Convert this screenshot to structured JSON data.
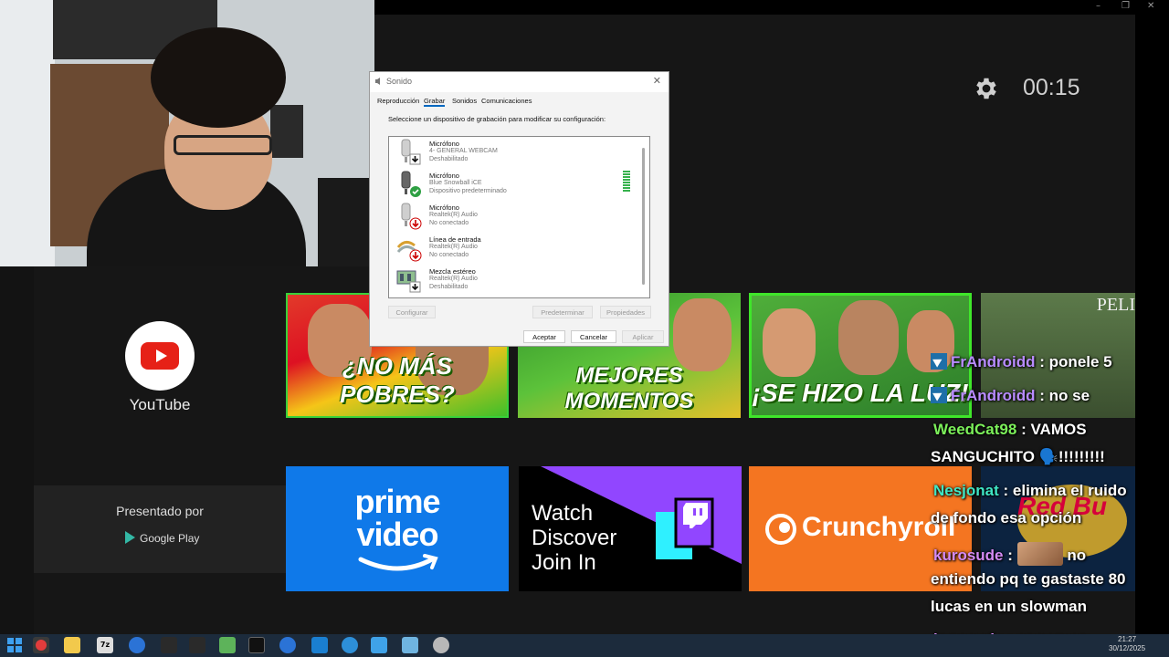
{
  "tv": {
    "clock": "00:15",
    "window_controls": [
      "–",
      "❐",
      "✕"
    ],
    "youtube_label": "YouTube",
    "thumbnails": [
      {
        "caption": "¿NO MÁS POBRES?"
      },
      {
        "caption": "MEJORES MOMENTOS"
      },
      {
        "caption": "¡SE HIZO LA LUZ!"
      },
      {
        "caption": "PELI"
      }
    ],
    "sponsored_title": "Presentado por",
    "sponsored_store": "Google Play",
    "apps": {
      "prime_line1": "prime",
      "prime_line2": "video",
      "twitch_line1": "Watch",
      "twitch_line2": "Discover",
      "twitch_line3": "Join In",
      "crunchyroll": "Crunchyroll"
    }
  },
  "dialog": {
    "title": "Sonido",
    "close": "✕",
    "tabs": [
      "Reproducción",
      "Grabar",
      "Sonidos",
      "Comunicaciones"
    ],
    "active_tab": "Grabar",
    "instruction": "Seleccione un dispositivo de grabación para modificar su configuración:",
    "devices": [
      {
        "name": "Micrófono",
        "device": "4- GENERAL WEBCAM",
        "status": "Deshabilitado",
        "icon": "microphone-icon"
      },
      {
        "name": "Micrófono",
        "device": "Blue Snowball iCE",
        "status": "Dispositivo predeterminado",
        "icon": "microphone-icon"
      },
      {
        "name": "Micrófono",
        "device": "Realtek(R) Audio",
        "status": "No conectado",
        "icon": "microphone-icon"
      },
      {
        "name": "Línea de entrada",
        "device": "Realtek(R) Audio",
        "status": "No conectado",
        "icon": "line-in-icon"
      },
      {
        "name": "Mezcla estéreo",
        "device": "Realtek(R) Audio",
        "status": "Deshabilitado",
        "icon": "stereo-mix-icon"
      }
    ],
    "buttons": {
      "configure": "Configurar",
      "set_default": "Predeterminar",
      "properties": "Propiedades",
      "ok": "Aceptar",
      "cancel": "Cancelar",
      "apply": "Aplicar"
    }
  },
  "chat": [
    {
      "user": "FrAndroidd",
      "text": ": ponele 5",
      "color": "#b98cff",
      "badge": true
    },
    {
      "user": "FrAndroidd",
      "text": ": no se",
      "color": "#b98cff",
      "badge": true
    },
    {
      "user": "WeedCat98",
      "text": ": VAMOS",
      "color": "#7cf05a",
      "badge": false
    },
    {
      "user": "",
      "text": "SANGUCHITO 🗣️!!!!!!!!!",
      "color": "#ffffff",
      "badge": false
    },
    {
      "user": "Nesjonat",
      "text": ": elimina el ruido",
      "color": "#3fe6c4",
      "badge": false
    },
    {
      "user": "",
      "text": "de fondo esa opción",
      "color": "#ffffff",
      "badge": false
    },
    {
      "user": "kurosude",
      "text": ":",
      "color": "#d58bf5",
      "badge": false,
      "emote": true,
      "after": "no"
    },
    {
      "user": "",
      "text": "entiendo pq te gastaste 80",
      "color": "#ffffff",
      "badge": false
    },
    {
      "user": "",
      "text": "lucas en un slowman",
      "color": "#ffffff",
      "badge": false
    },
    {
      "user": "kurosude",
      "text": ": snowman",
      "color": "#d58bf5",
      "badge": false
    }
  ],
  "taskbar": {
    "time": "21:27",
    "date": "30/12/2025"
  },
  "colors": {
    "prime": "#0f79e9",
    "crunchyroll": "#f47521",
    "youtube": "#e62117"
  }
}
